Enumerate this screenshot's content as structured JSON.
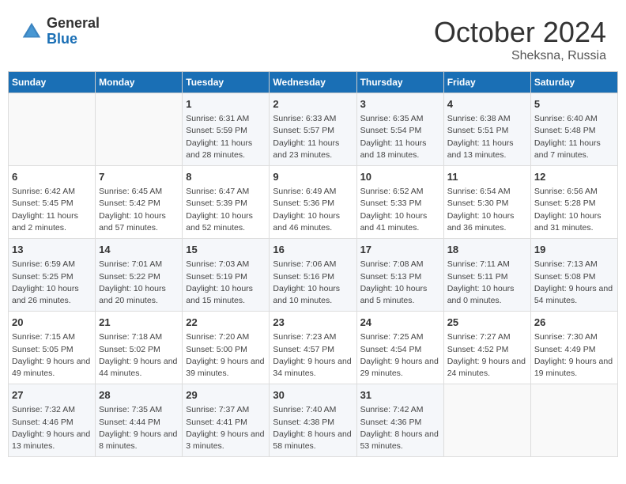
{
  "header": {
    "logo_general": "General",
    "logo_blue": "Blue",
    "month": "October 2024",
    "location": "Sheksna, Russia"
  },
  "days_of_week": [
    "Sunday",
    "Monday",
    "Tuesday",
    "Wednesday",
    "Thursday",
    "Friday",
    "Saturday"
  ],
  "weeks": [
    [
      {
        "day": null,
        "info": null
      },
      {
        "day": null,
        "info": null
      },
      {
        "day": "1",
        "info": "Sunrise: 6:31 AM\nSunset: 5:59 PM\nDaylight: 11 hours and 28 minutes."
      },
      {
        "day": "2",
        "info": "Sunrise: 6:33 AM\nSunset: 5:57 PM\nDaylight: 11 hours and 23 minutes."
      },
      {
        "day": "3",
        "info": "Sunrise: 6:35 AM\nSunset: 5:54 PM\nDaylight: 11 hours and 18 minutes."
      },
      {
        "day": "4",
        "info": "Sunrise: 6:38 AM\nSunset: 5:51 PM\nDaylight: 11 hours and 13 minutes."
      },
      {
        "day": "5",
        "info": "Sunrise: 6:40 AM\nSunset: 5:48 PM\nDaylight: 11 hours and 7 minutes."
      }
    ],
    [
      {
        "day": "6",
        "info": "Sunrise: 6:42 AM\nSunset: 5:45 PM\nDaylight: 11 hours and 2 minutes."
      },
      {
        "day": "7",
        "info": "Sunrise: 6:45 AM\nSunset: 5:42 PM\nDaylight: 10 hours and 57 minutes."
      },
      {
        "day": "8",
        "info": "Sunrise: 6:47 AM\nSunset: 5:39 PM\nDaylight: 10 hours and 52 minutes."
      },
      {
        "day": "9",
        "info": "Sunrise: 6:49 AM\nSunset: 5:36 PM\nDaylight: 10 hours and 46 minutes."
      },
      {
        "day": "10",
        "info": "Sunrise: 6:52 AM\nSunset: 5:33 PM\nDaylight: 10 hours and 41 minutes."
      },
      {
        "day": "11",
        "info": "Sunrise: 6:54 AM\nSunset: 5:30 PM\nDaylight: 10 hours and 36 minutes."
      },
      {
        "day": "12",
        "info": "Sunrise: 6:56 AM\nSunset: 5:28 PM\nDaylight: 10 hours and 31 minutes."
      }
    ],
    [
      {
        "day": "13",
        "info": "Sunrise: 6:59 AM\nSunset: 5:25 PM\nDaylight: 10 hours and 26 minutes."
      },
      {
        "day": "14",
        "info": "Sunrise: 7:01 AM\nSunset: 5:22 PM\nDaylight: 10 hours and 20 minutes."
      },
      {
        "day": "15",
        "info": "Sunrise: 7:03 AM\nSunset: 5:19 PM\nDaylight: 10 hours and 15 minutes."
      },
      {
        "day": "16",
        "info": "Sunrise: 7:06 AM\nSunset: 5:16 PM\nDaylight: 10 hours and 10 minutes."
      },
      {
        "day": "17",
        "info": "Sunrise: 7:08 AM\nSunset: 5:13 PM\nDaylight: 10 hours and 5 minutes."
      },
      {
        "day": "18",
        "info": "Sunrise: 7:11 AM\nSunset: 5:11 PM\nDaylight: 10 hours and 0 minutes."
      },
      {
        "day": "19",
        "info": "Sunrise: 7:13 AM\nSunset: 5:08 PM\nDaylight: 9 hours and 54 minutes."
      }
    ],
    [
      {
        "day": "20",
        "info": "Sunrise: 7:15 AM\nSunset: 5:05 PM\nDaylight: 9 hours and 49 minutes."
      },
      {
        "day": "21",
        "info": "Sunrise: 7:18 AM\nSunset: 5:02 PM\nDaylight: 9 hours and 44 minutes."
      },
      {
        "day": "22",
        "info": "Sunrise: 7:20 AM\nSunset: 5:00 PM\nDaylight: 9 hours and 39 minutes."
      },
      {
        "day": "23",
        "info": "Sunrise: 7:23 AM\nSunset: 4:57 PM\nDaylight: 9 hours and 34 minutes."
      },
      {
        "day": "24",
        "info": "Sunrise: 7:25 AM\nSunset: 4:54 PM\nDaylight: 9 hours and 29 minutes."
      },
      {
        "day": "25",
        "info": "Sunrise: 7:27 AM\nSunset: 4:52 PM\nDaylight: 9 hours and 24 minutes."
      },
      {
        "day": "26",
        "info": "Sunrise: 7:30 AM\nSunset: 4:49 PM\nDaylight: 9 hours and 19 minutes."
      }
    ],
    [
      {
        "day": "27",
        "info": "Sunrise: 7:32 AM\nSunset: 4:46 PM\nDaylight: 9 hours and 13 minutes."
      },
      {
        "day": "28",
        "info": "Sunrise: 7:35 AM\nSunset: 4:44 PM\nDaylight: 9 hours and 8 minutes."
      },
      {
        "day": "29",
        "info": "Sunrise: 7:37 AM\nSunset: 4:41 PM\nDaylight: 9 hours and 3 minutes."
      },
      {
        "day": "30",
        "info": "Sunrise: 7:40 AM\nSunset: 4:38 PM\nDaylight: 8 hours and 58 minutes."
      },
      {
        "day": "31",
        "info": "Sunrise: 7:42 AM\nSunset: 4:36 PM\nDaylight: 8 hours and 53 minutes."
      },
      {
        "day": null,
        "info": null
      },
      {
        "day": null,
        "info": null
      }
    ]
  ]
}
